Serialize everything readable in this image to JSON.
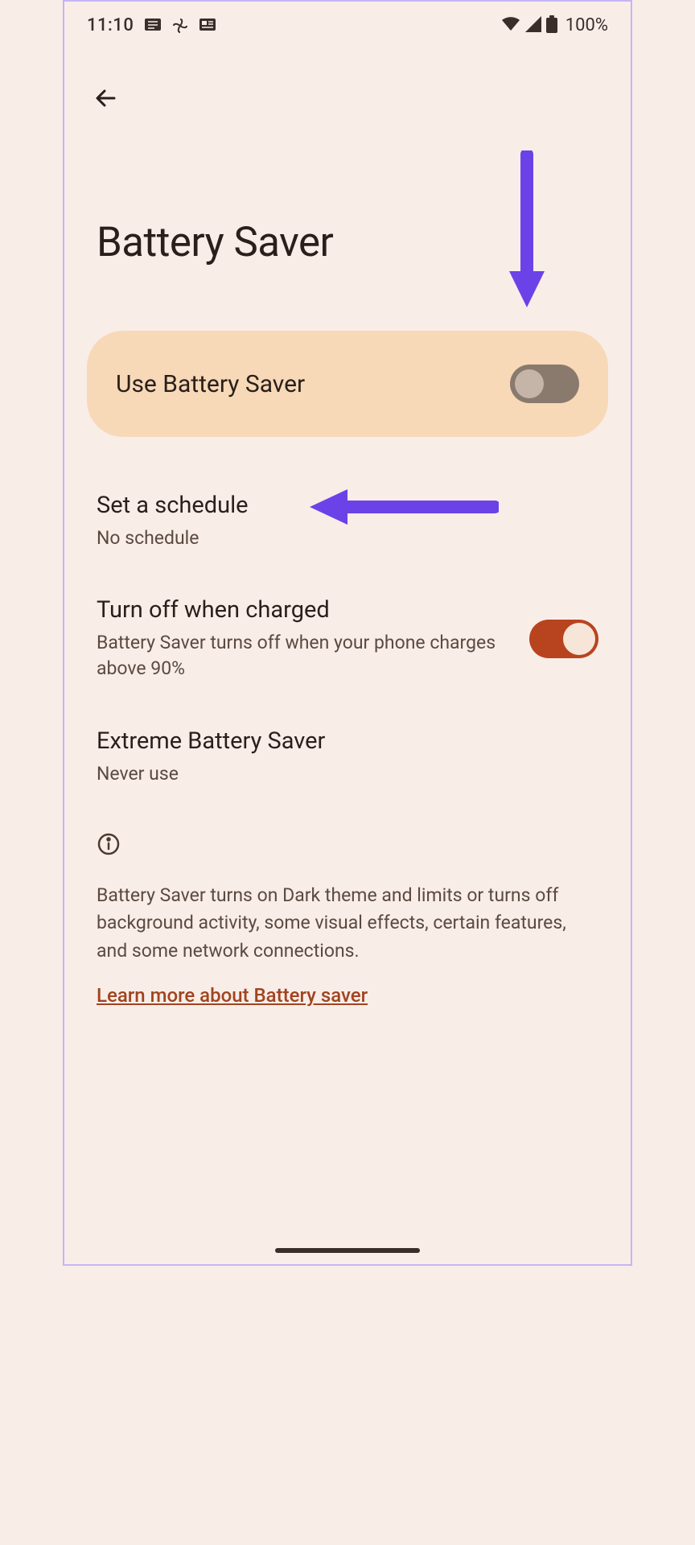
{
  "status_bar": {
    "time": "11:10",
    "battery_percent": "100%"
  },
  "page": {
    "title": "Battery Saver"
  },
  "main_toggle": {
    "label": "Use Battery Saver",
    "state": "off"
  },
  "settings": {
    "schedule": {
      "title": "Set a schedule",
      "subtitle": "No schedule"
    },
    "turn_off_charged": {
      "title": "Turn off when charged",
      "subtitle": "Battery Saver turns off when your phone charges above 90%",
      "state": "on"
    },
    "extreme": {
      "title": "Extreme Battery Saver",
      "subtitle": "Never use"
    }
  },
  "info": {
    "text": "Battery Saver turns on Dark theme and limits or turns off background activity, some visual effects, certain features, and some network connections.",
    "link": "Learn more about Battery saver"
  },
  "annotations": {
    "arrow_color": "#6b42e8"
  }
}
